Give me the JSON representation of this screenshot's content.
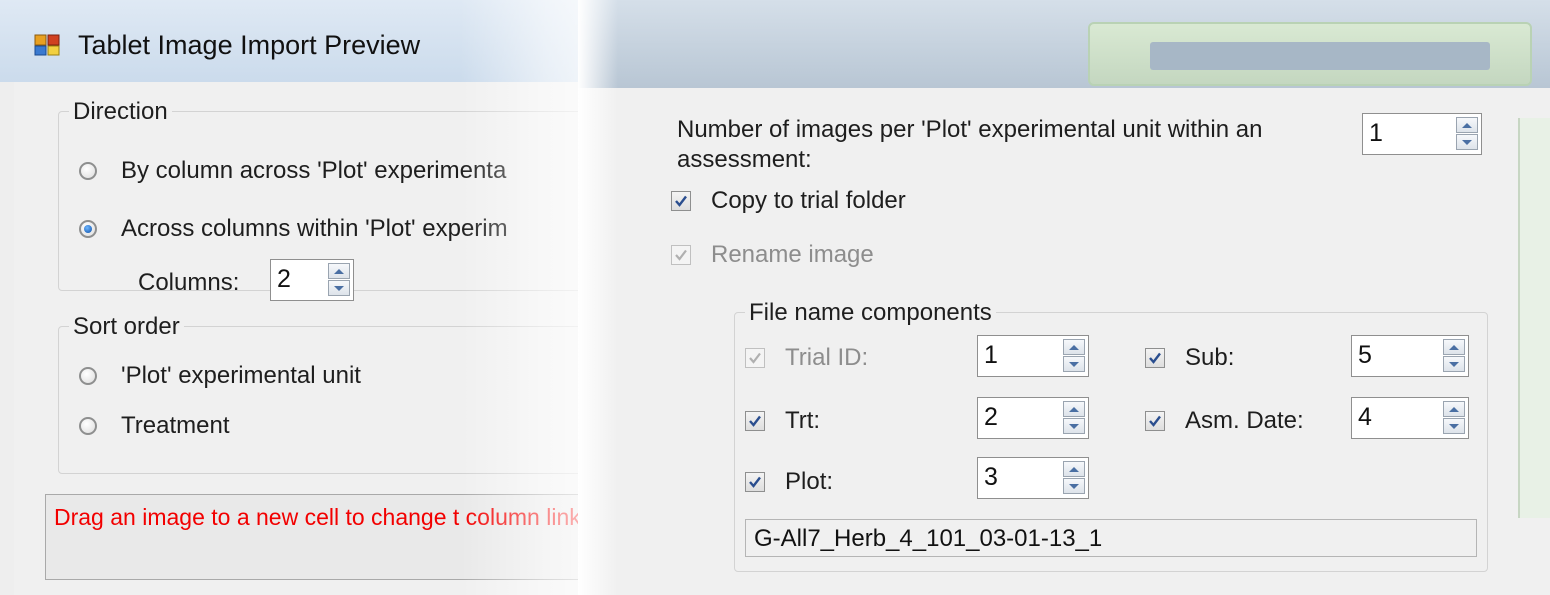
{
  "window": {
    "title": "Tablet Image Import Preview",
    "icon": "app-window-icon"
  },
  "direction": {
    "legend": "Direction",
    "options": [
      {
        "label": "By column across 'Plot' experimenta",
        "checked": false
      },
      {
        "label": "Across columns within 'Plot' experim",
        "checked": true
      }
    ],
    "columns_label": "Columns:",
    "columns_value": "2"
  },
  "sort_order": {
    "legend": "Sort order",
    "options": [
      {
        "label": "'Plot' experimental unit",
        "checked": false
      },
      {
        "label": "Treatment",
        "checked": false
      }
    ]
  },
  "hint": {
    "text": "Drag an image to a new cell to change t column linkage.",
    "color": "#f20000"
  },
  "images_per_unit": {
    "label_line1": "Number of images per 'Plot' experimental unit within an",
    "label_line2": "assessment:",
    "value": "1"
  },
  "copy_to_trial_folder": {
    "label": "Copy to trial folder",
    "checked": true,
    "enabled": true
  },
  "rename_image": {
    "label": "Rename image",
    "checked": true,
    "enabled": false
  },
  "file_name_components": {
    "legend": "File name components",
    "items": [
      {
        "label": "Trial ID:",
        "checked": true,
        "enabled": false,
        "value": "1"
      },
      {
        "label": "Trt:",
        "checked": true,
        "enabled": true,
        "value": "2"
      },
      {
        "label": "Plot:",
        "checked": true,
        "enabled": true,
        "value": "3"
      },
      {
        "label": "Sub:",
        "checked": true,
        "enabled": true,
        "value": "5"
      },
      {
        "label": "Asm. Date:",
        "checked": true,
        "enabled": true,
        "value": "4"
      }
    ],
    "preview": "G-All7_Herb_4_101_03-01-13_1"
  }
}
